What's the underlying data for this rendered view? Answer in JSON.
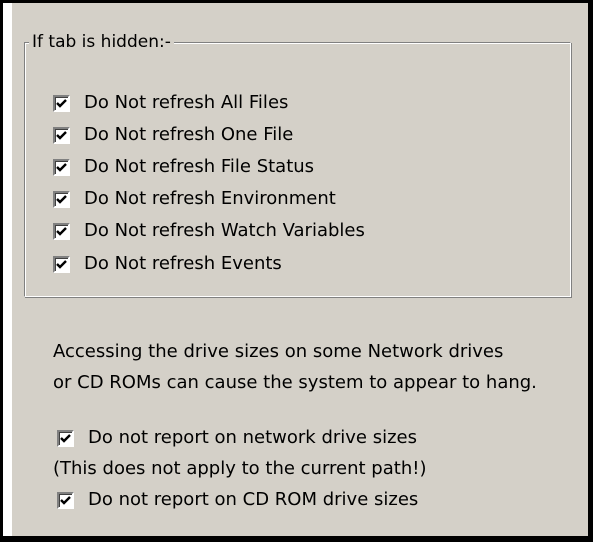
{
  "group": {
    "title": "If tab is hidden:-",
    "items": [
      {
        "label": "Do Not refresh All Files",
        "checked": true
      },
      {
        "label": "Do Not refresh One File",
        "checked": true
      },
      {
        "label": "Do Not refresh File Status",
        "checked": true
      },
      {
        "label": "Do Not refresh Environment",
        "checked": true
      },
      {
        "label": "Do Not refresh Watch Variables",
        "checked": true
      },
      {
        "label": "Do Not refresh Events",
        "checked": true
      }
    ]
  },
  "warning": {
    "line1": "Accessing the drive sizes on some Network drives",
    "line2": "or CD ROMs can cause the system to appear to hang."
  },
  "network_option": {
    "label": "Do not report on network drive sizes",
    "checked": true
  },
  "note": "(This does not apply to the current path!)",
  "cdrom_option": {
    "label": "Do not report on CD ROM drive sizes",
    "checked": true
  },
  "icons": {
    "checkbox_mark": "check-icon"
  }
}
